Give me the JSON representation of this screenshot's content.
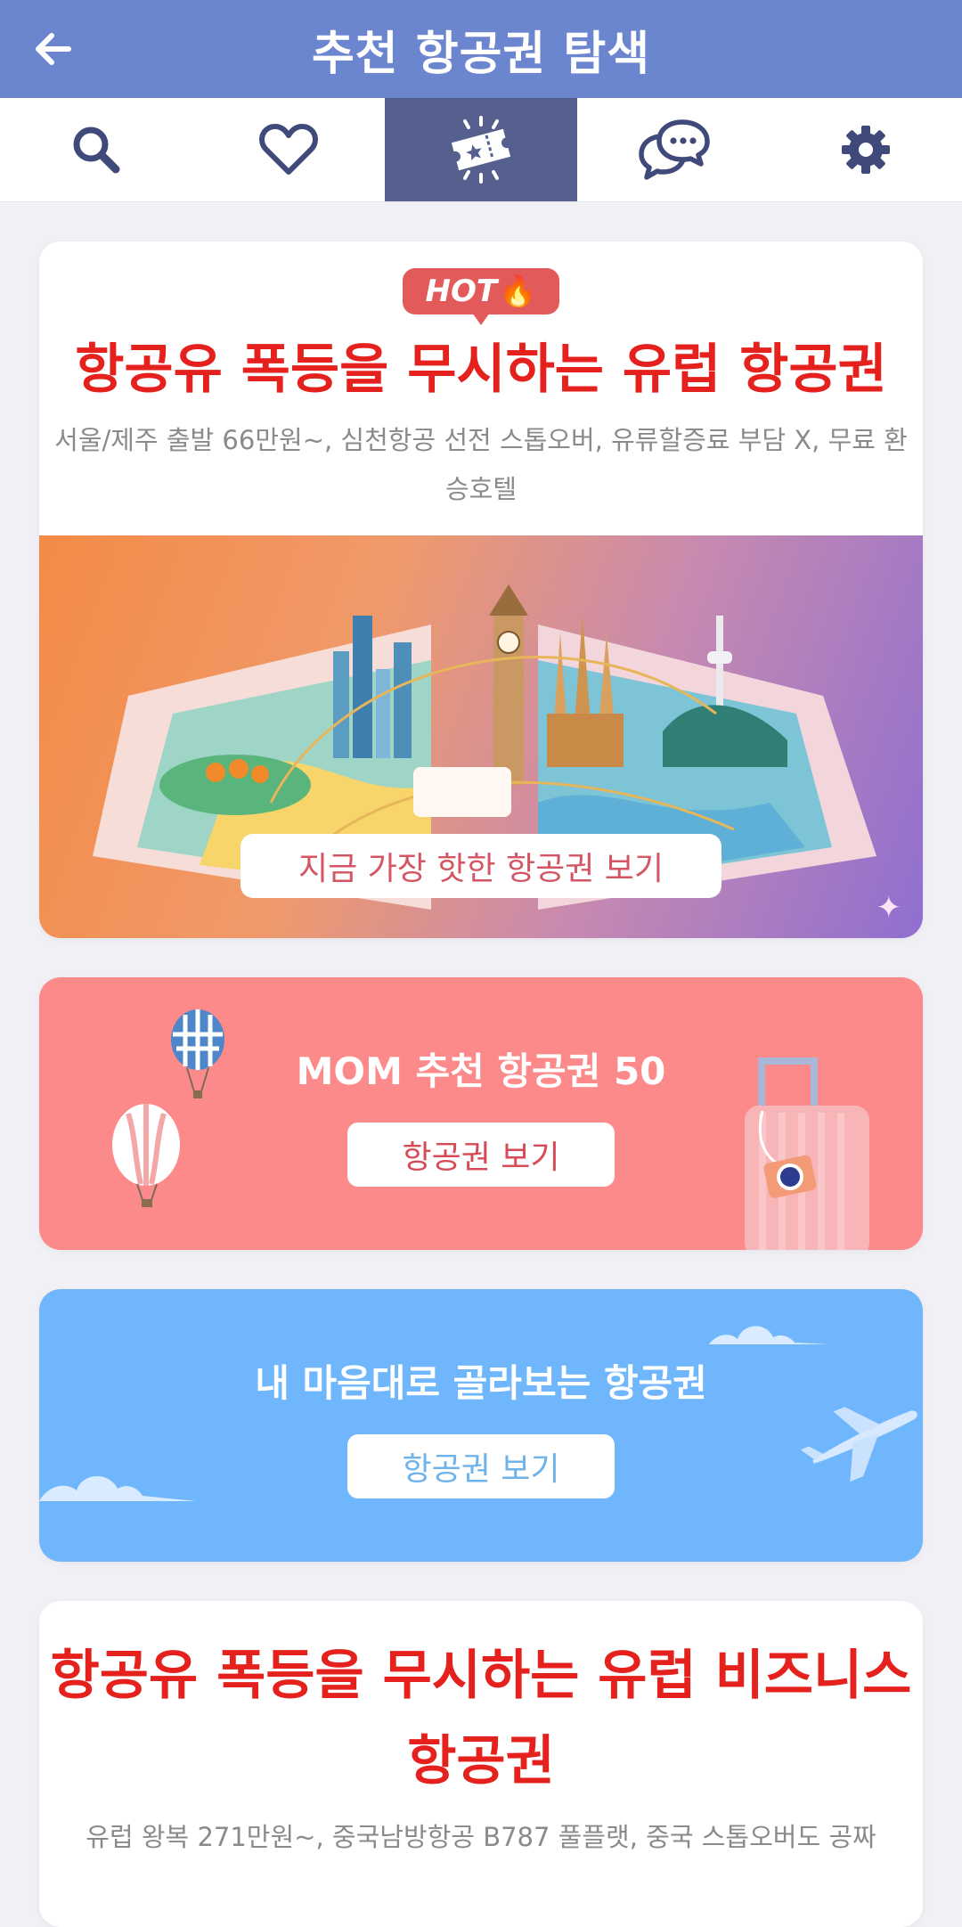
{
  "header": {
    "title": "추천 항공권 탐색",
    "back_icon": "arrow-left-icon"
  },
  "tabs": [
    {
      "icon": "search-icon",
      "active": false
    },
    {
      "icon": "heart-icon",
      "active": false
    },
    {
      "icon": "ticket-icon",
      "active": true
    },
    {
      "icon": "chat-bubbles-icon",
      "active": false
    },
    {
      "icon": "gear-icon",
      "active": false
    }
  ],
  "featured": {
    "badge": "HOT",
    "badge_icon": "flame-icon",
    "title": "항공유 폭등을 무시하는 유럽 항공권",
    "subtitle": "서울/제주 출발 66만원~, 심천항공 선전 스톱오버, 유류할증료 부담 X, 무료 환승호텔",
    "button": "지금 가장 핫한 항공권 보기"
  },
  "promo_mom": {
    "title": "MOM 추천 항공권 50",
    "button": "항공권 보기"
  },
  "promo_pick": {
    "title": "내 마음대로 골라보는 항공권",
    "button": "항공권 보기"
  },
  "business": {
    "title": "항공유 폭등을 무시하는 유럽 비즈니스 항공권",
    "subtitle": "유럽 왕복 271만원~, 중국남방항공 B787 풀플랫, 중국 스톱오버도 공짜"
  },
  "colors": {
    "header": "#6c85cf",
    "active_tab": "#56608f",
    "headline_red": "#e5211e",
    "promo_pink": "#fd8a8a",
    "promo_blue": "#6fb6fc"
  }
}
